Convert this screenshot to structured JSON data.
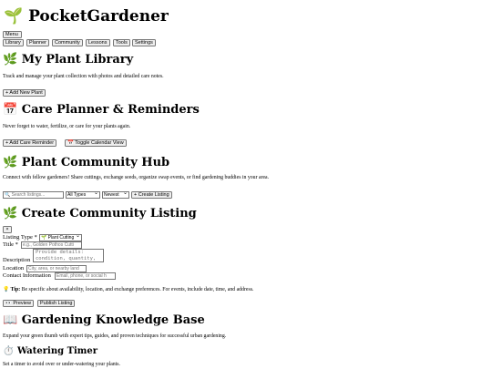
{
  "header": {
    "icon": "🌱",
    "title": "PocketGardener"
  },
  "nav": {
    "menu_label": "Menu",
    "items": [
      "Library",
      "Planner",
      "Community",
      "Lessons",
      "Tools",
      "Settings"
    ]
  },
  "library": {
    "icon": "🌿",
    "title": "My Plant Library",
    "description": "Track and manage your plant collection with photos and detailed care notes.",
    "add_button": "+ Add New Plant"
  },
  "planner": {
    "icon": "📅",
    "title": "Care Planner & Reminders",
    "description": "Never forget to water, fertilize, or care for your plants again.",
    "add_button": "+ Add Care Reminder",
    "calendar_button": "📅 Toggle Calendar View"
  },
  "community": {
    "icon": "🌿",
    "title": "Plant Community Hub",
    "description": "Connect with fellow gardeners! Share cuttings, exchange seeds, organize swap events, or find gardening buddies in your area.",
    "search_placeholder": "🔍 Search listings...",
    "type_filter": "All Types",
    "sort": "Newest",
    "create_button": "+ Create Listing"
  },
  "listing_form": {
    "icon": "🌿",
    "title": "Create Community Listing",
    "close_label": "×",
    "type_label": "Listing Type *",
    "type_value": "🌱 Plant Cutting",
    "title_label": "Title *",
    "title_placeholder": "e.g., Golden Pothos Cutti",
    "description_label": "Description",
    "description_placeholder": "Provide details:\ncondition, quantity,",
    "location_label": "Location",
    "location_placeholder": "City, area, or nearby land",
    "contact_label": "Contact Information",
    "contact_placeholder": "Email, phone, or social h",
    "tip_icon": "💡",
    "tip_label": "Tip:",
    "tip_text": "Be specific about availability, location, and exchange preferences. For events, include date, time, and address.",
    "preview_button": "👀 Preview",
    "publish_button": "Publish Listing"
  },
  "knowledge": {
    "icon": "📖",
    "title": "Gardening Knowledge Base",
    "description": "Expand your green thumb with expert tips, guides, and proven techniques for successful urban gardening."
  },
  "timer": {
    "icon": "⏱️",
    "title": "Watering Timer",
    "description": "Set a timer to avoid over or under-watering your plants."
  }
}
